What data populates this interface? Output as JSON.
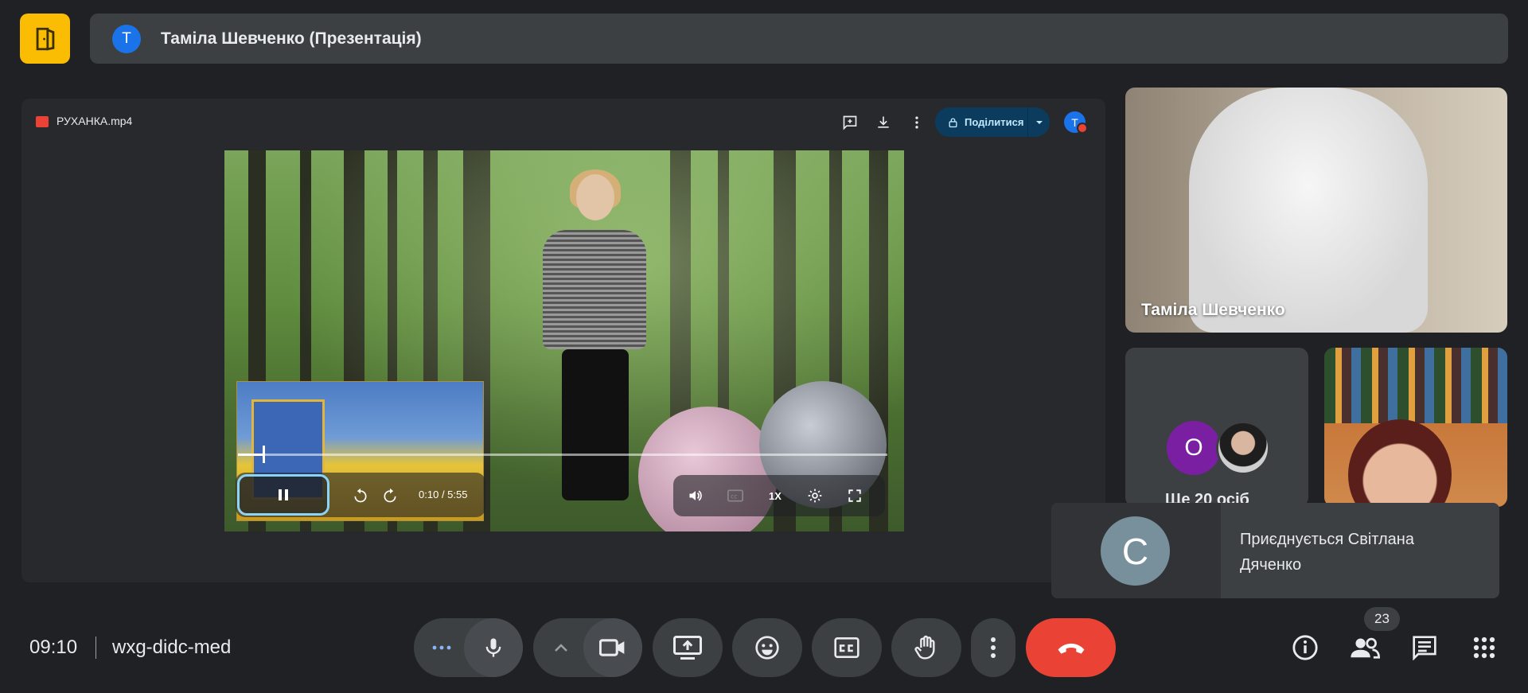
{
  "header": {
    "avatar_letter": "T",
    "title": "Таміла Шевченко (Презентація)"
  },
  "presentation": {
    "file_name": "РУХАНКА.mp4",
    "share_label": "Поділитися",
    "avatar_letter": "T",
    "video": {
      "current_time": "0:10",
      "duration": "/ 5:55",
      "speed": "1X",
      "progress": 0.038
    }
  },
  "tiles": {
    "main_name": "Таміла Шевченко",
    "group_avatar_letter": "О",
    "group_text": "Ще 20 осіб"
  },
  "notification": {
    "avatar_letter": "С",
    "text": "Приєднується Світлана Дяченко"
  },
  "footer": {
    "clock": "09:10",
    "meeting_code": "wxg-didc-med",
    "participants_count": "23"
  },
  "icons": {
    "logo": "door-icon",
    "more": "more-dots-icon",
    "mic": "microphone-icon",
    "camera": "camera-icon",
    "present": "present-screen-icon",
    "emoji": "emoji-icon",
    "captions": "captions-icon",
    "hand": "raise-hand-icon",
    "end": "end-call-icon",
    "info": "info-icon",
    "people": "people-icon",
    "chat": "chat-icon",
    "apps": "apps-grid-icon"
  },
  "colors": {
    "background": "#202124",
    "surface": "#3c4043",
    "logo": "#fbbc04",
    "end_call": "#ea4335",
    "accent_blue": "#1a73e8",
    "share_bg": "#0b3c5d"
  }
}
